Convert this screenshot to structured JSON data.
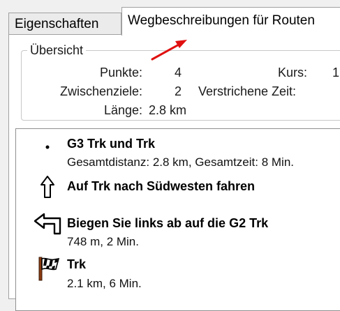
{
  "tabs": [
    {
      "label": "Eigenschaften",
      "active": false
    },
    {
      "label": "Wegbeschreibungen für Routen",
      "active": true
    }
  ],
  "overview": {
    "title": "Übersicht",
    "points_label": "Punkte:",
    "points_value": "4",
    "waypoints_label": "Zwischenziele:",
    "waypoints_value": "2",
    "length_label": "Länge:",
    "length_value": "2.8 km",
    "course_label": "Kurs:",
    "course_value": "1",
    "elapsed_label": "Verstrichene Zeit:"
  },
  "directions": [
    {
      "icon": "bullet-icon",
      "title": "G3 Trk und Trk",
      "detail": "Gesamtdistanz: 2.8 km, Gesamtzeit: 8 Min."
    },
    {
      "icon": "arrow-up-icon",
      "title": "Auf Trk nach Südwesten fahren",
      "detail": ""
    },
    {
      "icon": "turn-left-icon",
      "title": "Biegen Sie links ab auf die G2 Trk",
      "detail": "748 m, 2 Min."
    },
    {
      "icon": "checkered-flag-icon",
      "title": "Trk",
      "detail": "2.1 km, 6 Min."
    }
  ],
  "annotation": {
    "icon": "red-arrow-icon",
    "color": "#e01010"
  }
}
